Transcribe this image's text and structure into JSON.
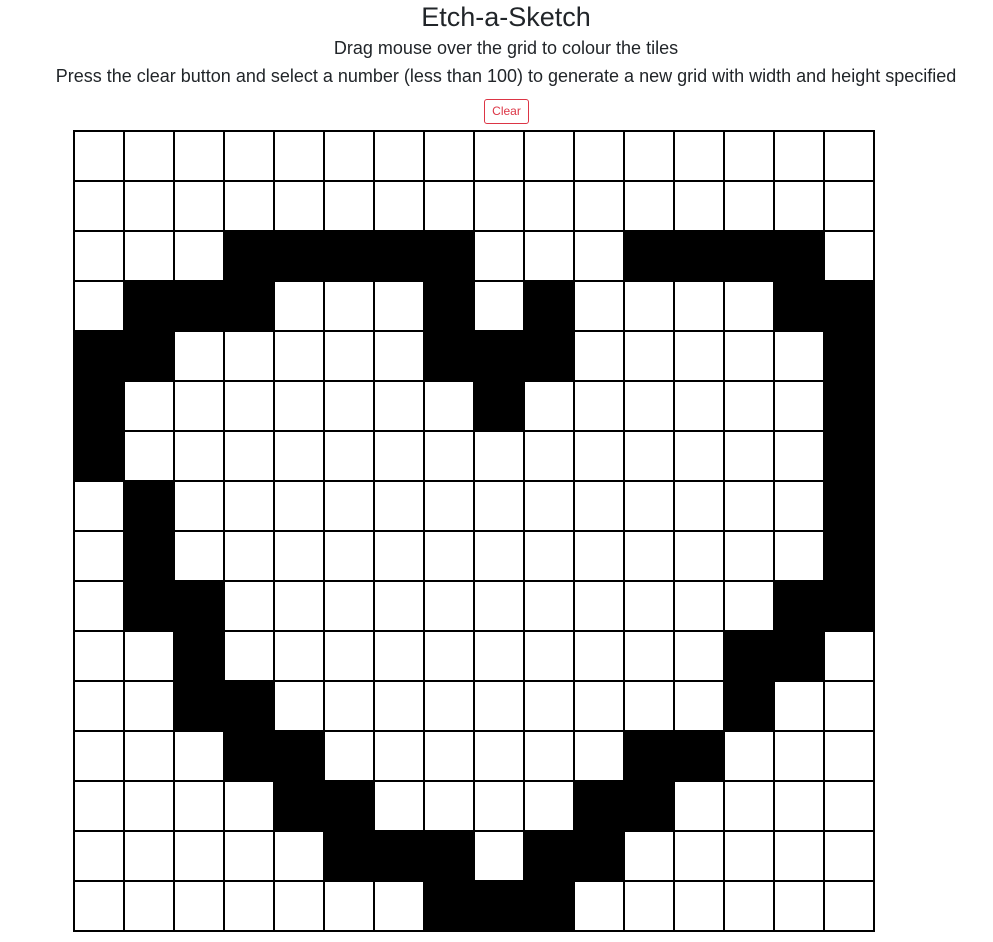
{
  "page": {
    "title": "Etch-a-Sketch",
    "subtitle": "Drag mouse over the grid to colour the tiles",
    "instructions": "Press the clear button and select a number (less than 100) to generate a new grid with width and height specified"
  },
  "toolbar": {
    "clear_label": "Clear"
  },
  "colors": {
    "filled": "#000000",
    "empty": "#ffffff",
    "clear_button": "#dc3545"
  },
  "grid": {
    "size": 16,
    "rows": [
      "0000000000000000",
      "0000000000000000",
      "0001111100011110",
      "0111000101000011",
      "1100000111000001",
      "1000000010000001",
      "1000000000000001",
      "0100000000000001",
      "0100000000000001",
      "0110000000000011",
      "0010000000000110",
      "0011000000000100",
      "0001100000011000",
      "0000110000110000",
      "0000011101100000",
      "0000000111000000"
    ]
  }
}
